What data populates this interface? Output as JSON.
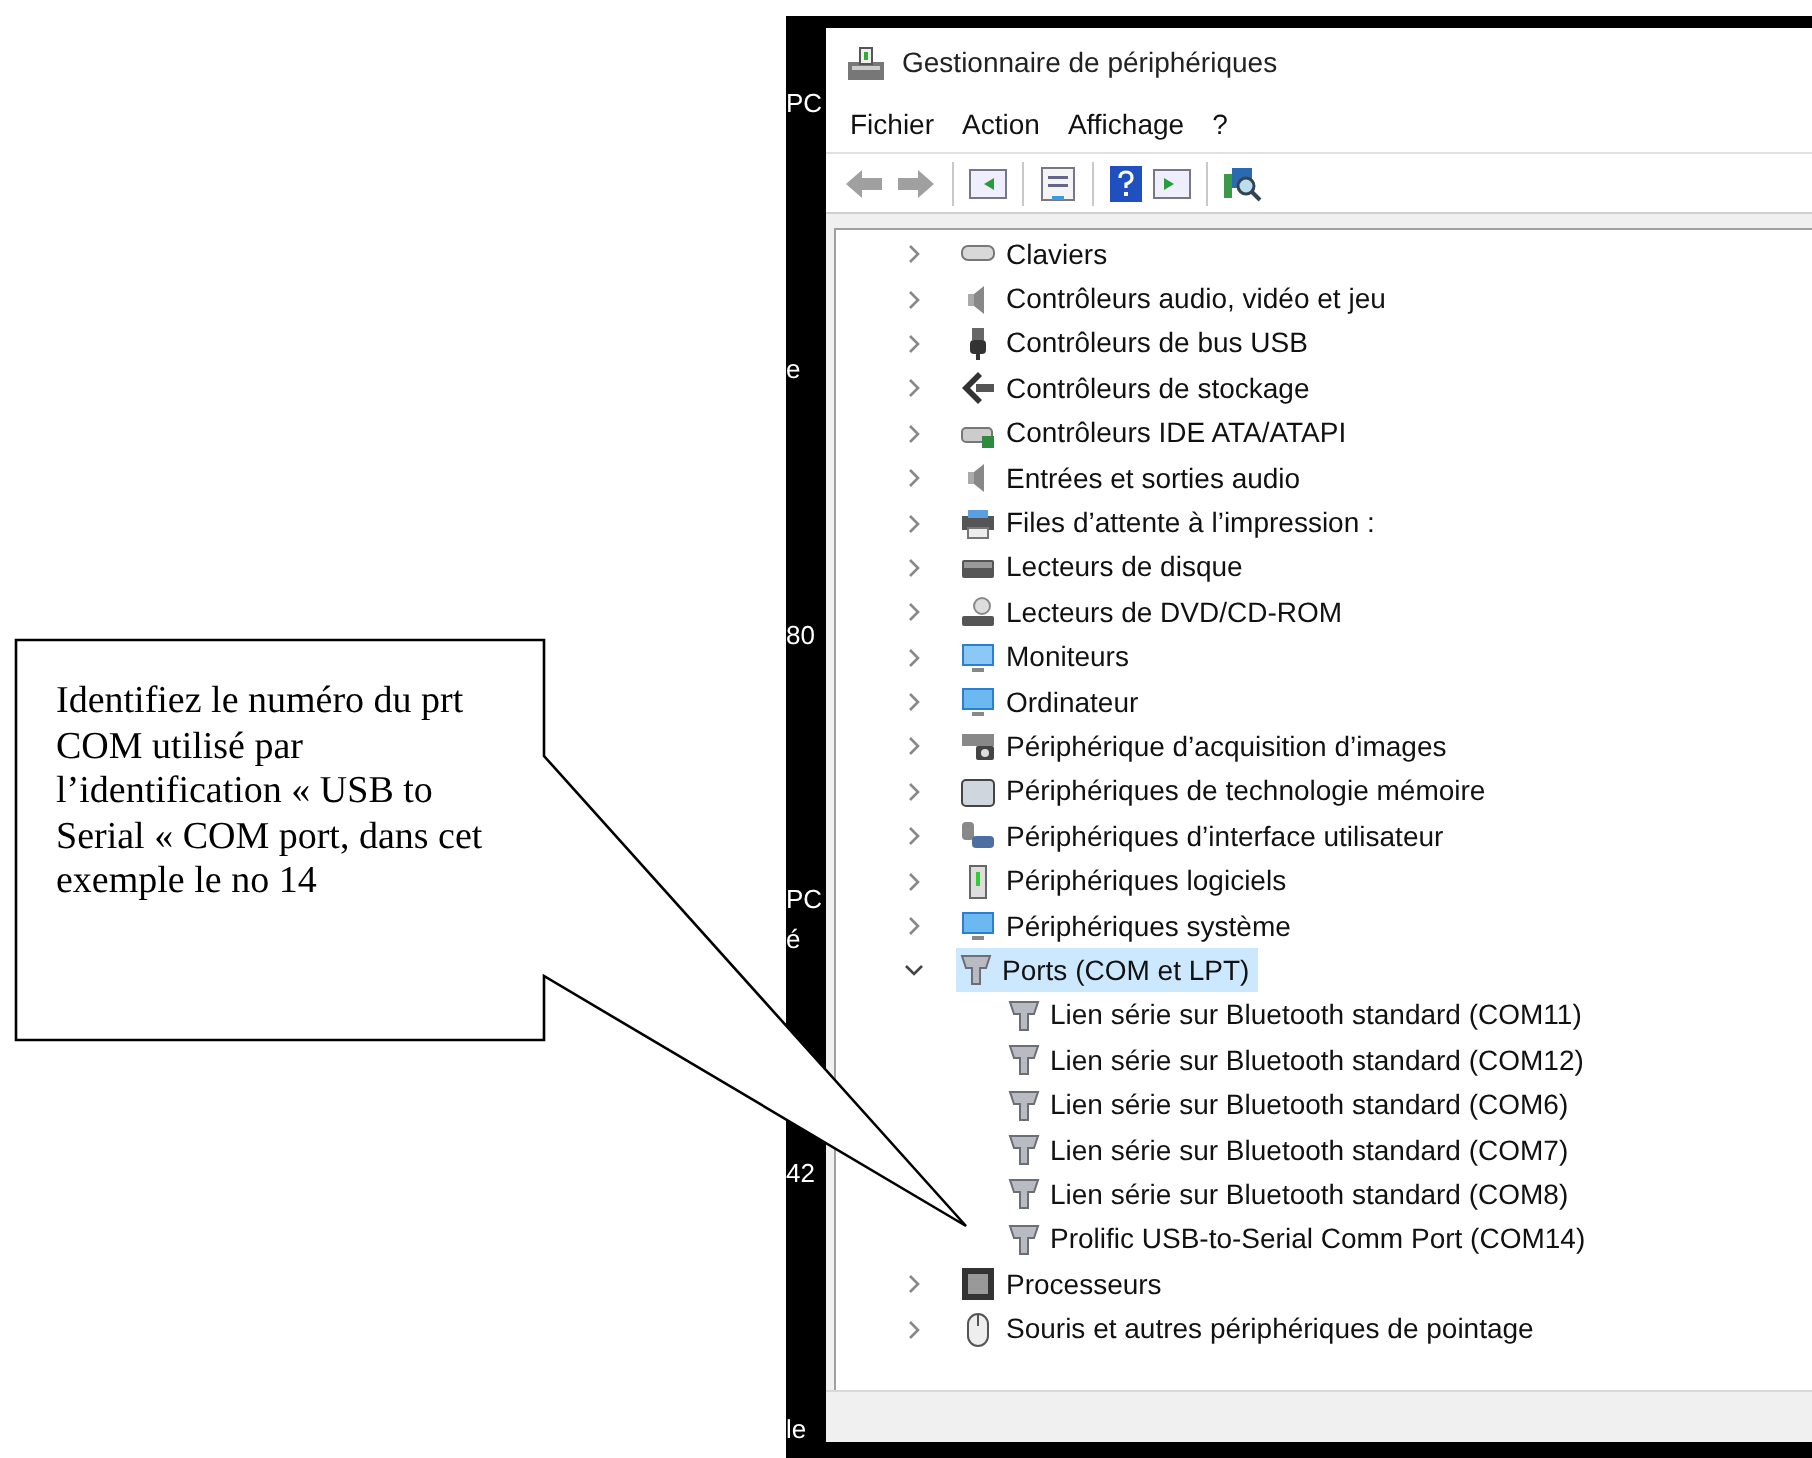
{
  "desktop_labels": [
    "PC",
    "e",
    "80",
    "PC",
    "é",
    "42",
    "le"
  ],
  "window": {
    "title": "Gestionnaire de périphériques",
    "menu": [
      "Fichier",
      "Action",
      "Affichage",
      "?"
    ],
    "toolbar": [
      {
        "kind": "back",
        "disabled": true
      },
      {
        "kind": "forward",
        "disabled": true
      },
      {
        "kind": "separator"
      },
      {
        "kind": "console"
      },
      {
        "kind": "separator"
      },
      {
        "kind": "properties"
      },
      {
        "kind": "separator"
      },
      {
        "kind": "help"
      },
      {
        "kind": "action"
      },
      {
        "kind": "separator"
      },
      {
        "kind": "scan"
      }
    ],
    "tree": [
      {
        "label": "Claviers",
        "expanded": false,
        "selected": false
      },
      {
        "label": "Contrôleurs audio, vidéo et jeu",
        "expanded": false,
        "selected": false
      },
      {
        "label": "Contrôleurs de bus USB",
        "expanded": false,
        "selected": false
      },
      {
        "label": "Contrôleurs de stockage",
        "expanded": false,
        "selected": false
      },
      {
        "label": "Contrôleurs IDE ATA/ATAPI",
        "expanded": false,
        "selected": false
      },
      {
        "label": "Entrées et sorties audio",
        "expanded": false,
        "selected": false
      },
      {
        "label": "Files d’attente à l’impression :",
        "expanded": false,
        "selected": false
      },
      {
        "label": "Lecteurs de disque",
        "expanded": false,
        "selected": false
      },
      {
        "label": "Lecteurs de DVD/CD-ROM",
        "expanded": false,
        "selected": false
      },
      {
        "label": "Moniteurs",
        "expanded": false,
        "selected": false
      },
      {
        "label": "Ordinateur",
        "expanded": false,
        "selected": false
      },
      {
        "label": "Périphérique d’acquisition d’images",
        "expanded": false,
        "selected": false
      },
      {
        "label": "Périphériques de technologie mémoire",
        "expanded": false,
        "selected": false
      },
      {
        "label": "Périphériques d’interface utilisateur",
        "expanded": false,
        "selected": false
      },
      {
        "label": "Périphériques logiciels",
        "expanded": false,
        "selected": false
      },
      {
        "label": "Périphériques système",
        "expanded": false,
        "selected": false
      },
      {
        "label": "Ports (COM et LPT)",
        "expanded": true,
        "selected": true,
        "children": [
          {
            "label": "Lien série sur Bluetooth standard (COM11)",
            "selected": false
          },
          {
            "label": "Lien série sur Bluetooth standard (COM12)",
            "selected": false
          },
          {
            "label": "Lien série sur Bluetooth standard (COM6)",
            "selected": false
          },
          {
            "label": "Lien série sur Bluetooth standard (COM7)",
            "selected": false
          },
          {
            "label": "Lien série sur Bluetooth standard (COM8)",
            "selected": false
          },
          {
            "label": "Prolific USB-to-Serial Comm Port (COM14)",
            "selected": false
          }
        ]
      },
      {
        "label": "Processeurs",
        "expanded": false,
        "selected": false
      },
      {
        "label": "Souris et autres périphériques de pointage",
        "expanded": false,
        "selected": false
      }
    ]
  },
  "callout": {
    "text": "Identifiez le numéro du prt COM utilisé par l’identification « USB to Serial «  COM port, dans cet exemple le no 14"
  }
}
